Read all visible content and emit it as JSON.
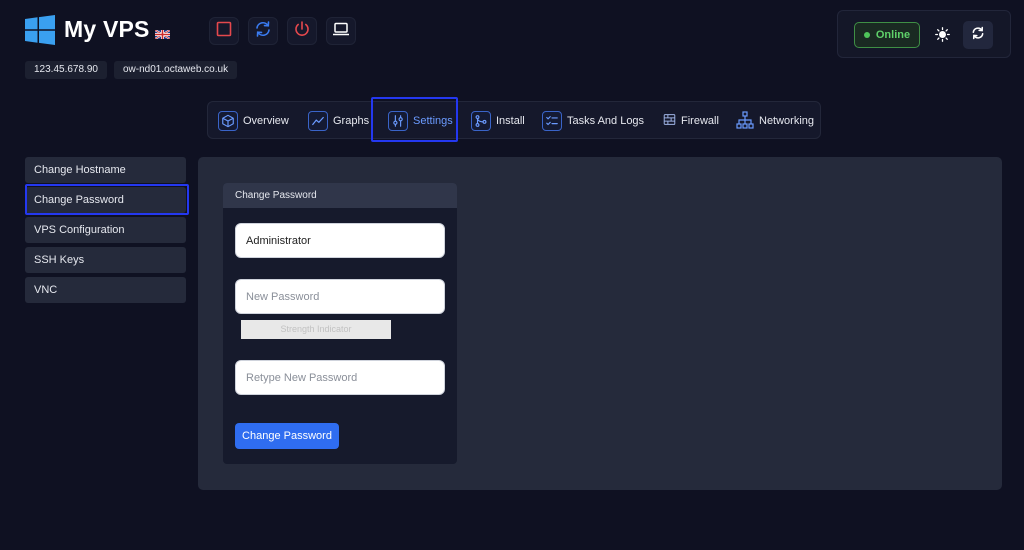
{
  "header": {
    "title": "My VPS",
    "toolbar": [
      {
        "name": "stop-button",
        "icon": "stop-square-icon",
        "color": "#e5484d"
      },
      {
        "name": "restart-button",
        "icon": "restart-icon",
        "color": "#3a7bf0"
      },
      {
        "name": "power-button",
        "icon": "power-icon",
        "color": "#e5484d"
      },
      {
        "name": "console-button",
        "icon": "laptop-icon",
        "color": "#ffffff"
      }
    ],
    "ip_address": "123.45.678.90",
    "hostname": "ow-nd01.octaweb.co.uk"
  },
  "status": {
    "label": "Online",
    "color": "#5fd16a"
  },
  "tabs": [
    {
      "label": "Overview",
      "icon": "cube-icon"
    },
    {
      "label": "Graphs",
      "icon": "line-chart-icon"
    },
    {
      "label": "Settings",
      "icon": "sliders-icon",
      "active": true
    },
    {
      "label": "Install",
      "icon": "git-merge-icon"
    },
    {
      "label": "Tasks And Logs",
      "icon": "checklist-icon"
    },
    {
      "label": "Firewall",
      "icon": "firewall-icon"
    },
    {
      "label": "Networking",
      "icon": "network-icon"
    }
  ],
  "sidebar": {
    "items": [
      {
        "label": "Change Hostname"
      },
      {
        "label": "Change Password",
        "active": true
      },
      {
        "label": "VPS Configuration"
      },
      {
        "label": "SSH Keys"
      },
      {
        "label": "VNC"
      }
    ]
  },
  "form": {
    "title": "Change Password",
    "username_value": "Administrator",
    "new_password_placeholder": "New Password",
    "strength_label": "Strength Indicator",
    "retype_placeholder": "Retype New Password",
    "submit_label": "Change Password"
  },
  "colors": {
    "accent": "#2f6df0",
    "highlight": "#2438f0",
    "background": "#0f1122"
  }
}
